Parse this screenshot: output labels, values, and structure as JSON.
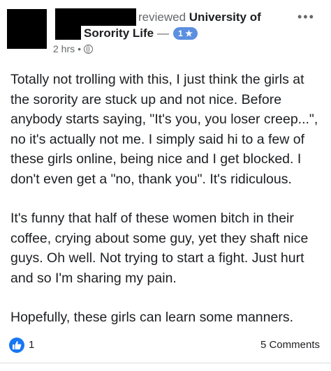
{
  "post": {
    "action_text": "reviewed",
    "page_name_line1": "University of",
    "page_name_line2": "Sorority Life",
    "separator": "—",
    "rating_badge": "1 ★",
    "time": "2 hrs",
    "meta_dot": "•",
    "more_label": "•••",
    "paragraphs": [
      "Totally not trolling with this, I just think the girls at the sorority are stuck up and not nice. Before anybody starts saying, \"It's you, you loser creep...\", no it's actually not me. I simply said hi to a few of these girls online, being nice and I get blocked. I don't even get a \"no, thank you\". It's ridiculous.",
      "It's funny that half of these women bitch in their coffee, crying about some guy, yet they shaft nice guys. Oh well. Not trying to start a fight. Just hurt and so I'm sharing my pain.",
      "Hopefully, these girls can learn some manners."
    ]
  },
  "footer": {
    "like_count": "1",
    "comments": "5 Comments"
  },
  "icons": {
    "like": "thumbs-up-icon",
    "privacy": "globe-icon",
    "more": "more-options-icon"
  },
  "colors": {
    "accent": "#1877f2",
    "badge": "#5b8fe0",
    "text": "#1c1e21",
    "secondary": "#65676b"
  }
}
